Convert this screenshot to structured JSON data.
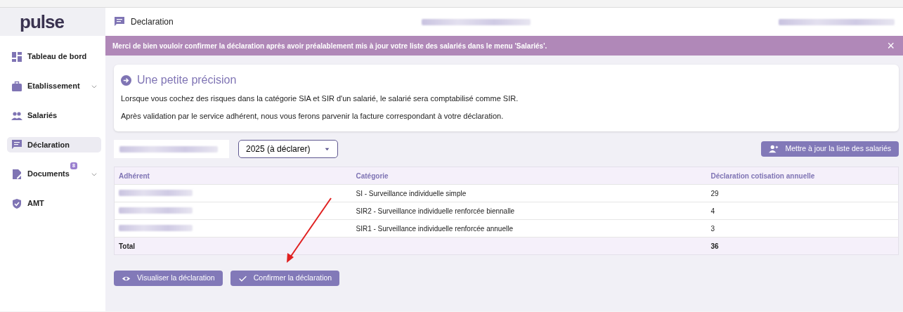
{
  "sidebar": {
    "logo": "pulse",
    "items": [
      {
        "label": "Tableau de bord",
        "selected": false,
        "expandable": false
      },
      {
        "label": "Etablissement",
        "selected": false,
        "expandable": true
      },
      {
        "label": "Salariés",
        "selected": false,
        "expandable": false
      },
      {
        "label": "Déclaration",
        "selected": true,
        "expandable": false
      },
      {
        "label": "Documents",
        "selected": false,
        "expandable": true,
        "badge": "8"
      },
      {
        "label": "AMT",
        "selected": false,
        "expandable": false
      }
    ]
  },
  "header": {
    "title": "Declaration"
  },
  "banner": {
    "text": "Merci de bien vouloir confirmer la déclaration après avoir préalablement mis à jour votre liste des salariés dans le menu 'Salariés'.",
    "close": "×"
  },
  "info_card": {
    "title": "Une petite précision",
    "paragraphs": [
      "Lorsque vous cochez des risques dans la catégorie SIA et SIR d'un salarié, le salarié sera comptabilisé comme SIR.",
      "Après validation par le service adhérent, nous vous ferons parvenir la facture correspondant à votre déclaration."
    ]
  },
  "filters": {
    "year_select": "2025 (à déclarer)",
    "update_button": "Mettre à jour la liste des salariés"
  },
  "table": {
    "columns": [
      "Adhérent",
      "Catégorie",
      "Déclaration cotisation annuelle"
    ],
    "rows": [
      {
        "category": "SI - Surveillance individuelle simple",
        "value": "29"
      },
      {
        "category": "SIR2 - Surveillance individuelle renforcée biennalle",
        "value": "4"
      },
      {
        "category": "SIR1 - Surveillance individuelle renforcée annuelle",
        "value": "3"
      }
    ],
    "total": {
      "label": "Total",
      "value": "36"
    }
  },
  "actions": [
    {
      "label": "Visualiser la déclaration"
    },
    {
      "label": "Confirmer la déclaration"
    }
  ]
}
